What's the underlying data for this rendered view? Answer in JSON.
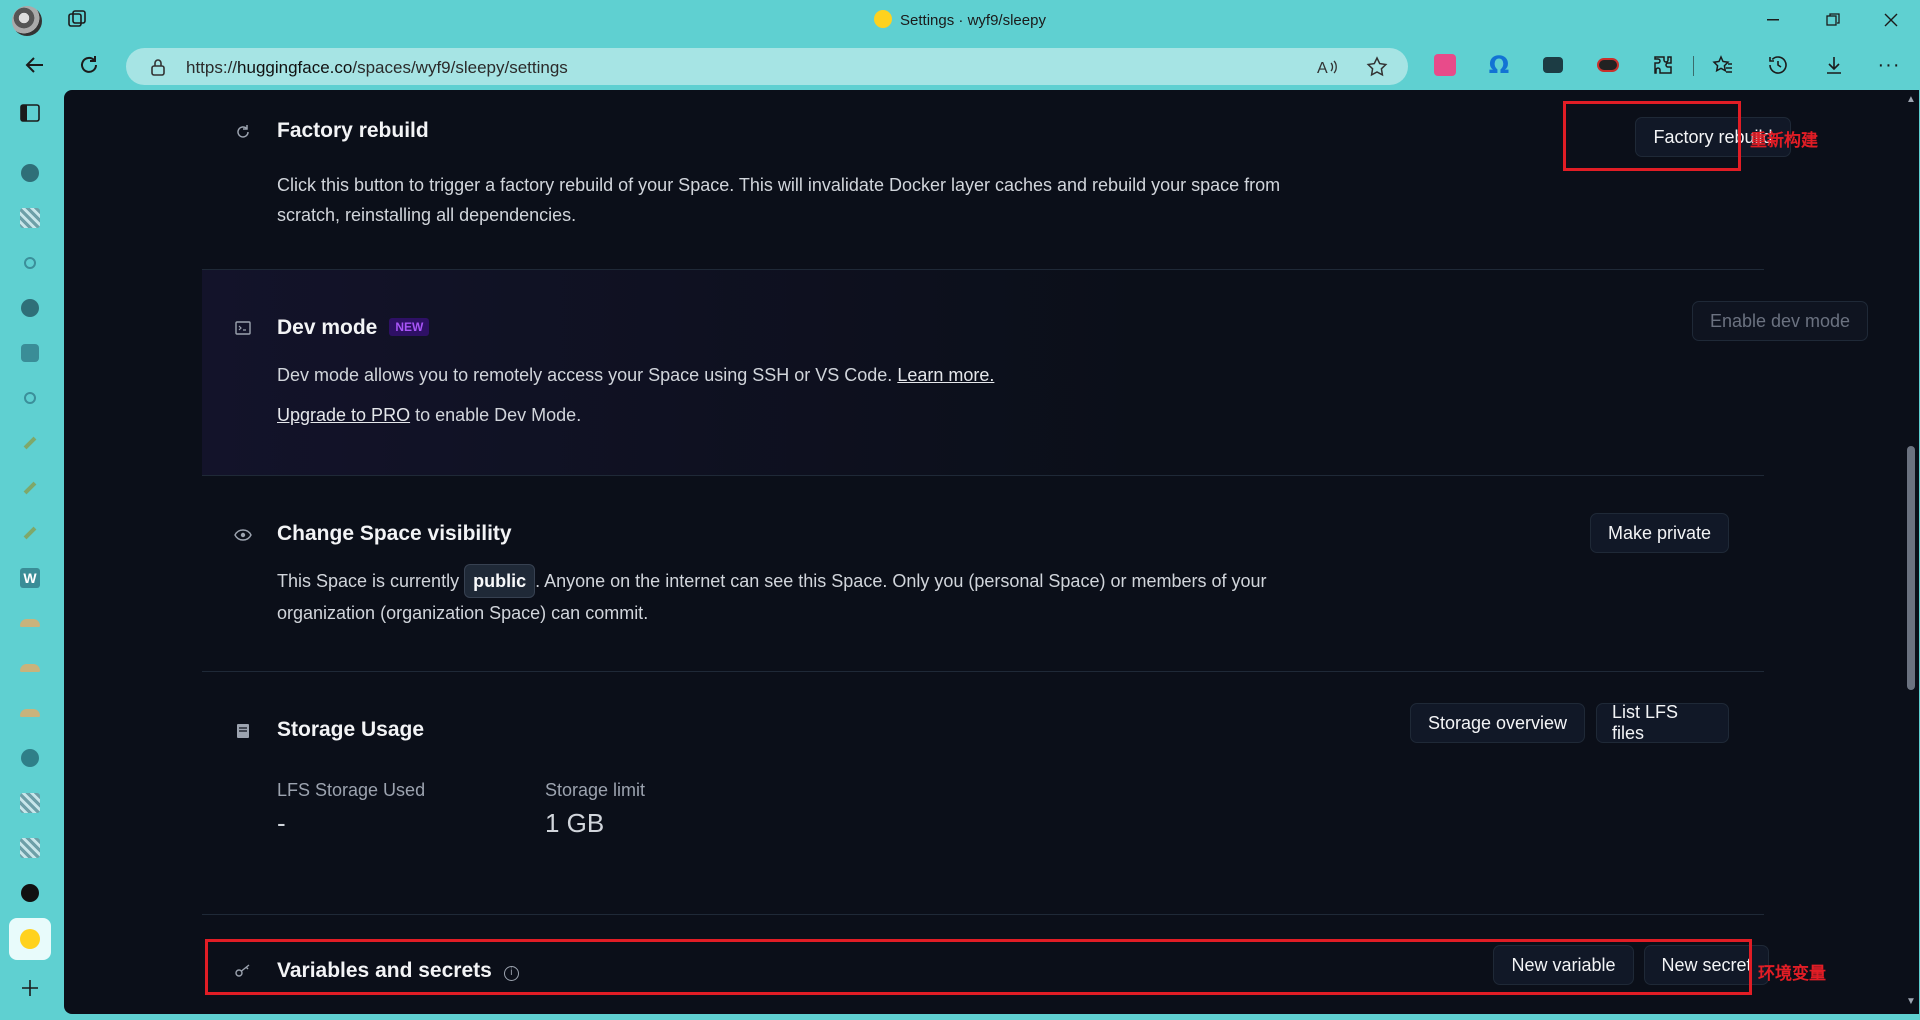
{
  "window": {
    "title": "Settings · wyf9/sleepy"
  },
  "address_bar": {
    "url_prefix": "https://",
    "url_host": "huggingface.co",
    "url_path": "/spaces/wyf9/sleepy/settings"
  },
  "sections": {
    "factory_rebuild": {
      "title": "Factory rebuild",
      "description": "Click this button to trigger a factory rebuild of your Space. This will invalidate Docker layer caches and rebuild your space from scratch, reinstalling all dependencies.",
      "button": "Factory rebuild"
    },
    "dev_mode": {
      "title": "Dev mode",
      "badge": "NEW",
      "description": "Dev mode allows you to remotely access your Space using SSH or VS Code.",
      "learn_more": "Learn more.",
      "upgrade_link": "Upgrade to PRO",
      "upgrade_rest": "to enable Dev Mode.",
      "button": "Enable dev mode"
    },
    "visibility": {
      "title": "Change Space visibility",
      "desc_before": "This Space is currently",
      "status": "public",
      "desc_after": ". Anyone on the internet can see this Space. Only you (personal Space) or members of your organization (organization Space) can commit.",
      "button": "Make private"
    },
    "storage": {
      "title": "Storage Usage",
      "overview_button": "Storage overview",
      "lfs_button": "List LFS files",
      "used_label": "LFS Storage Used",
      "used_value": "-",
      "limit_label": "Storage limit",
      "limit_value": "1 GB"
    },
    "variables": {
      "title": "Variables and secrets",
      "new_variable_button": "New variable",
      "new_secret_button": "New secret"
    }
  },
  "annotations": {
    "rebuild_note": "重新构建",
    "env_note": "环境变量",
    "color": "#e11d25"
  }
}
